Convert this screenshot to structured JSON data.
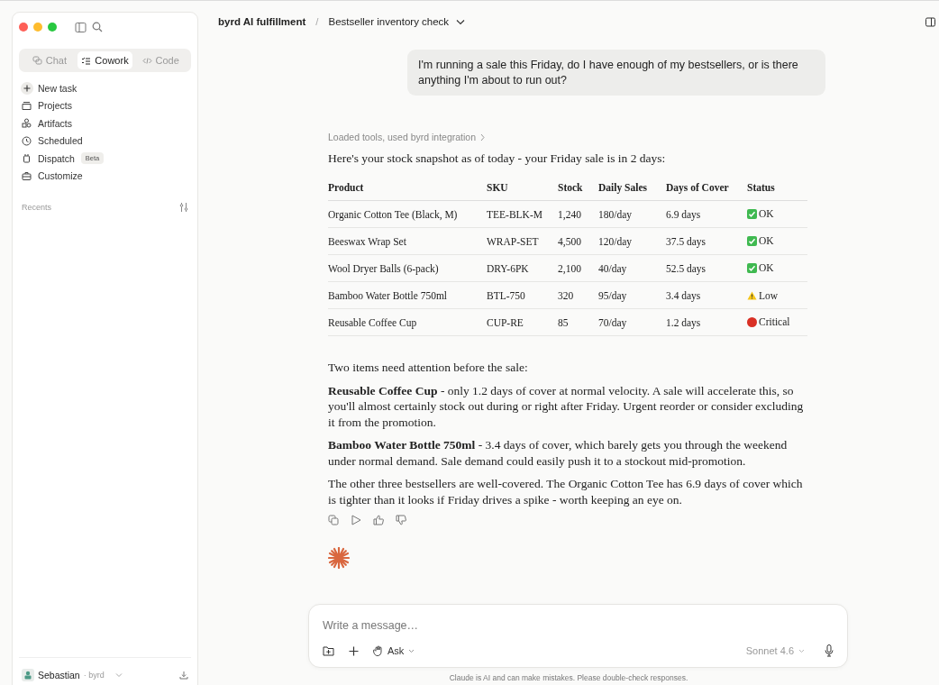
{
  "sidebar": {
    "modes": [
      {
        "label": "Chat",
        "selected": false
      },
      {
        "label": "Cowork",
        "selected": true
      },
      {
        "label": "Code",
        "selected": false
      }
    ],
    "nav": [
      "New task",
      "Projects",
      "Artifacts",
      "Scheduled",
      "Dispatch",
      "Customize"
    ],
    "nav_badge": "Beta",
    "recents_label": "Recents",
    "user": {
      "name": "Sebastian",
      "org": "· byrd"
    }
  },
  "header": {
    "workspace": "byrd AI fulfillment",
    "separator": "/",
    "title": "Bestseller inventory check"
  },
  "user_message": "I'm running a sale this Friday, do I have enough of my bestsellers, or is there anything I'm about to run out?",
  "tools_line": "Loaded tools, used byrd integration",
  "intro": "Here's your stock snapshot as of today - your Friday sale is in 2 days:",
  "table": {
    "columns": [
      "Product",
      "SKU",
      "Stock",
      "Daily Sales",
      "Days of Cover",
      "Status"
    ],
    "rows": [
      {
        "cells": [
          "Organic Cotton Tee (Black, M)",
          "TEE-BLK-M",
          "1,240",
          "180/day",
          "6.9 days"
        ],
        "status": {
          "kind": "ok",
          "label": "OK"
        }
      },
      {
        "cells": [
          "Beeswax Wrap Set",
          "WRAP-SET",
          "4,500",
          "120/day",
          "37.5 days"
        ],
        "status": {
          "kind": "ok",
          "label": "OK"
        }
      },
      {
        "cells": [
          "Wool Dryer Balls (6-pack)",
          "DRY-6PK",
          "2,100",
          "40/day",
          "52.5 days"
        ],
        "status": {
          "kind": "ok",
          "label": "OK"
        }
      },
      {
        "cells": [
          "Bamboo Water Bottle 750ml",
          "BTL-750",
          "320",
          "95/day",
          "3.4 days"
        ],
        "status": {
          "kind": "low",
          "label": "Low"
        }
      },
      {
        "cells": [
          "Reusable Coffee Cup",
          "CUP-RE",
          "85",
          "70/day",
          "1.2 days"
        ],
        "status": {
          "kind": "critical",
          "label": "Critical"
        }
      }
    ]
  },
  "paragraphs": [
    "Two items need attention before the sale:",
    "**Reusable Coffee Cup** - only 1.2 days of cover at normal velocity. A sale will accelerate this, so you'll almost certainly stock out during or right after Friday. Urgent reorder or consider excluding it from the promotion.",
    "**Bamboo Water Bottle 750ml** - 3.4 days of cover, which barely gets you through the weekend under normal demand. Sale demand could easily push it to a stockout mid-promotion.",
    "The other three bestsellers are well-covered. The Organic Cotton Tee has 6.9 days of cover which is tighter than it looks if Friday drives a spike - worth keeping an eye on."
  ],
  "composer": {
    "placeholder": "Write a message…",
    "mode": "Ask",
    "model": "Sonnet 4.6"
  },
  "disclaimer": "Claude is AI and can make mistakes. Please double-check responses."
}
